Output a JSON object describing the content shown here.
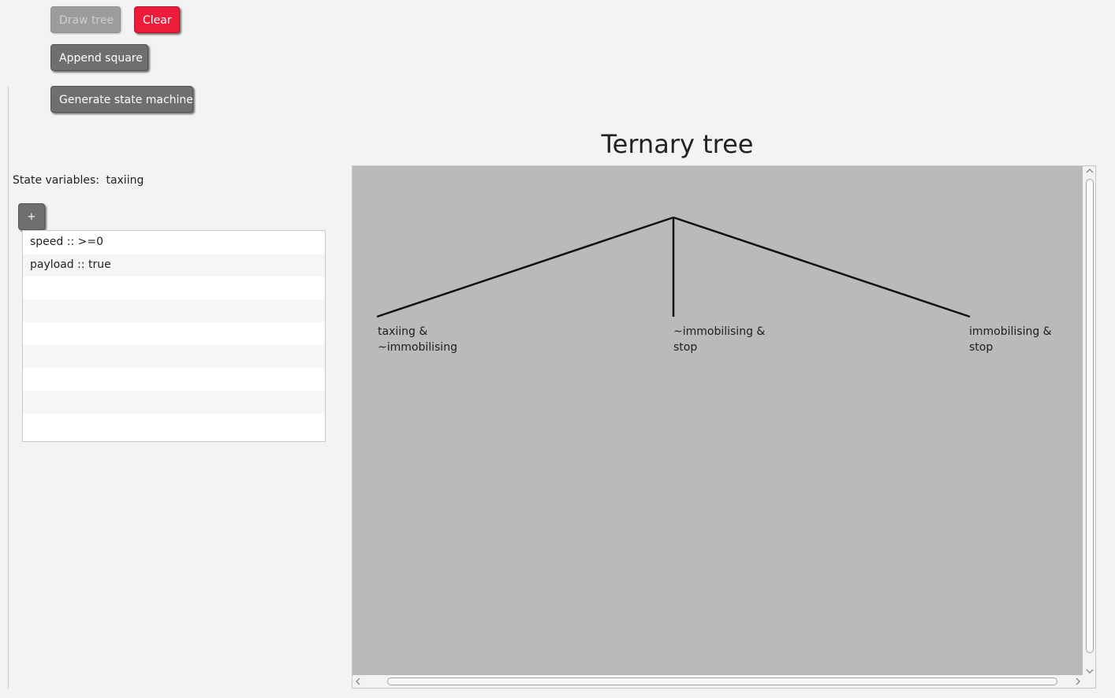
{
  "toolbar": {
    "draw_tree_label": "Draw tree",
    "clear_label": "Clear",
    "append_square_label": "Append square",
    "generate_label": "Generate state machine"
  },
  "state": {
    "label": "State variables:",
    "value": "taxiing",
    "add_label": "+"
  },
  "variables": [
    "speed :: >=0",
    "payload :: true",
    "",
    "",
    "",
    "",
    "",
    "",
    ""
  ],
  "tree": {
    "title": "Ternary tree",
    "nodes": [
      {
        "line1": "taxiing &",
        "line2": "~immobilising"
      },
      {
        "line1": "~immobilising &",
        "line2": "stop"
      },
      {
        "line1": "immobilising &",
        "line2": "stop"
      }
    ]
  },
  "icons": {
    "scroll_up": "scroll-up-icon",
    "scroll_down": "scroll-down-icon",
    "scroll_left": "scroll-left-icon",
    "scroll_right": "scroll-right-icon"
  },
  "colors": {
    "clear_button": "#ee1c3a",
    "canvas": "#bababa",
    "button": "#6f6f6f"
  }
}
